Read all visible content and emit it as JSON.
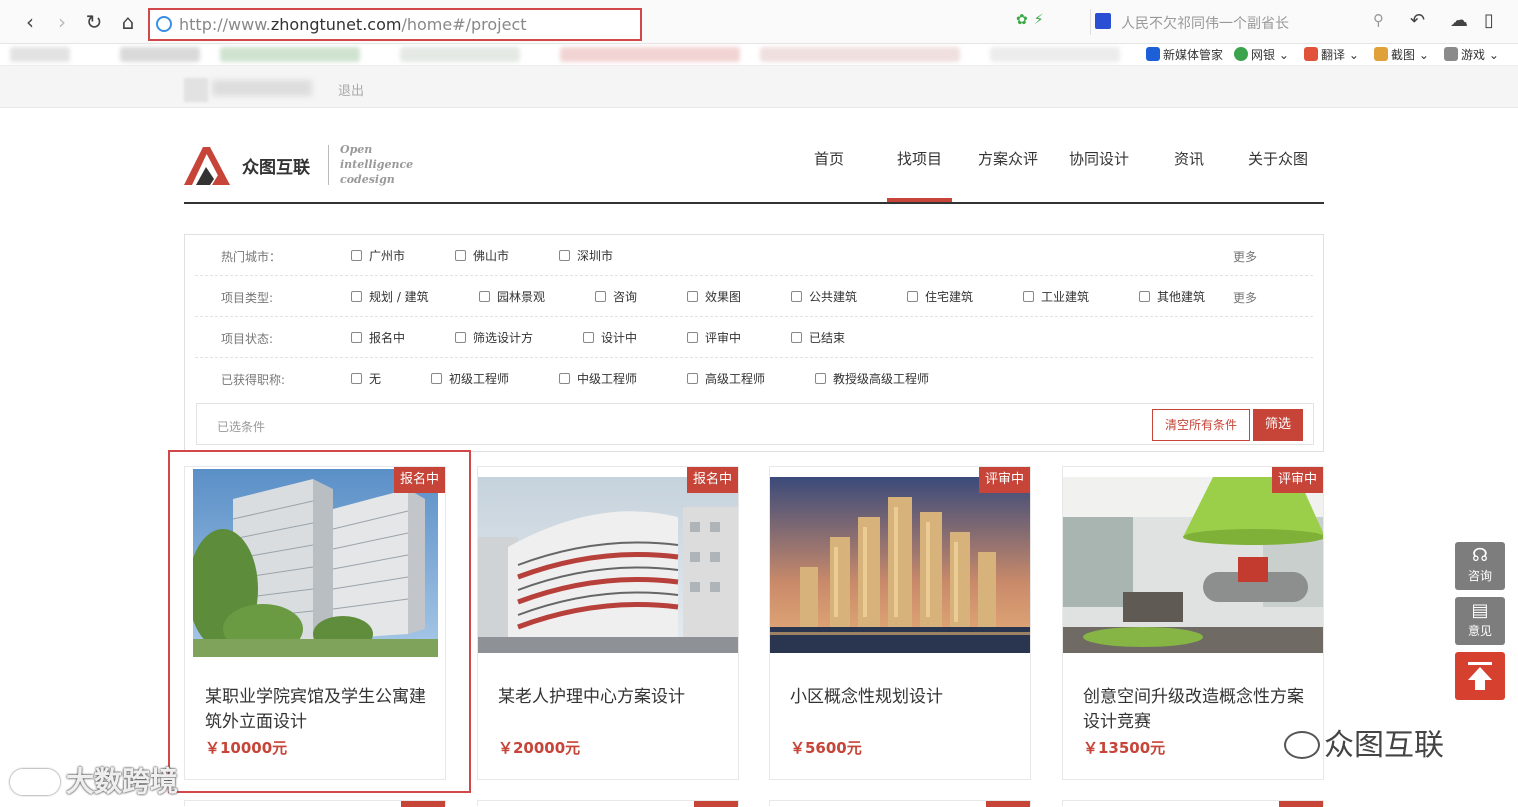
{
  "browser": {
    "url_prefix": "http://www.",
    "url_domain": "zhongtunet.com",
    "url_path": "/home#/project",
    "search_text": "人民不欠祁同伟一个副省长"
  },
  "bookmarks": [
    {
      "label": "新媒体管家",
      "color": "#1d5fd6"
    },
    {
      "label": "网银",
      "color": "#3aa34b"
    },
    {
      "label": "翻译",
      "color": "#e0533a"
    },
    {
      "label": "截图",
      "color": "#e0a13a"
    },
    {
      "label": "游戏",
      "color": "#8a8a8a"
    }
  ],
  "userbar": {
    "logout": "退出"
  },
  "logo": {
    "name": "众图互联",
    "slogan_1": "Open",
    "slogan_2": "intelligence",
    "slogan_3": "codesign"
  },
  "nav": [
    {
      "label": "首页"
    },
    {
      "label": "找项目"
    },
    {
      "label": "方案众评"
    },
    {
      "label": "协同设计"
    },
    {
      "label": "资讯"
    },
    {
      "label": "关于众图"
    }
  ],
  "filters": {
    "more": "更多",
    "rows": [
      {
        "label": "热门城市：",
        "options": [
          "广州市",
          "佛山市",
          "深圳市"
        ]
      },
      {
        "label": "项目类型:",
        "options": [
          "规划 / 建筑",
          "园林景观",
          "咨询",
          "效果图",
          "公共建筑",
          "住宅建筑",
          "工业建筑",
          "其他建筑"
        ]
      },
      {
        "label": "项目状态:",
        "options": [
          "报名中",
          "筛选设计方",
          "设计中",
          "评审中",
          "已结束"
        ]
      },
      {
        "label": "已获得职称:",
        "options": [
          "无",
          "初级工程师",
          "中级工程师",
          "高级工程师",
          "教授级高级工程师"
        ]
      }
    ],
    "selected_label": "已选条件",
    "clear_all": "清空所有条件",
    "filter_button": "筛选"
  },
  "projects": [
    {
      "status": "报名中",
      "title": "某职业学院宾馆及学生公寓建筑外立面设计",
      "price": "￥10000元"
    },
    {
      "status": "报名中",
      "title": "某老人护理中心方案设计",
      "price": "￥20000元"
    },
    {
      "status": "评审中",
      "title": "小区概念性规划设计",
      "price": "￥5600元"
    },
    {
      "status": "评审中",
      "title": "创意空间升级改造概念性方案设计竞赛",
      "price": "￥13500元"
    }
  ],
  "side": {
    "consult": "咨询",
    "feedback": "意见"
  },
  "watermarks": {
    "left": "大数跨境",
    "right": "众图互联"
  },
  "colors": {
    "accent": "#c64438",
    "annotation": "#d0484a"
  }
}
